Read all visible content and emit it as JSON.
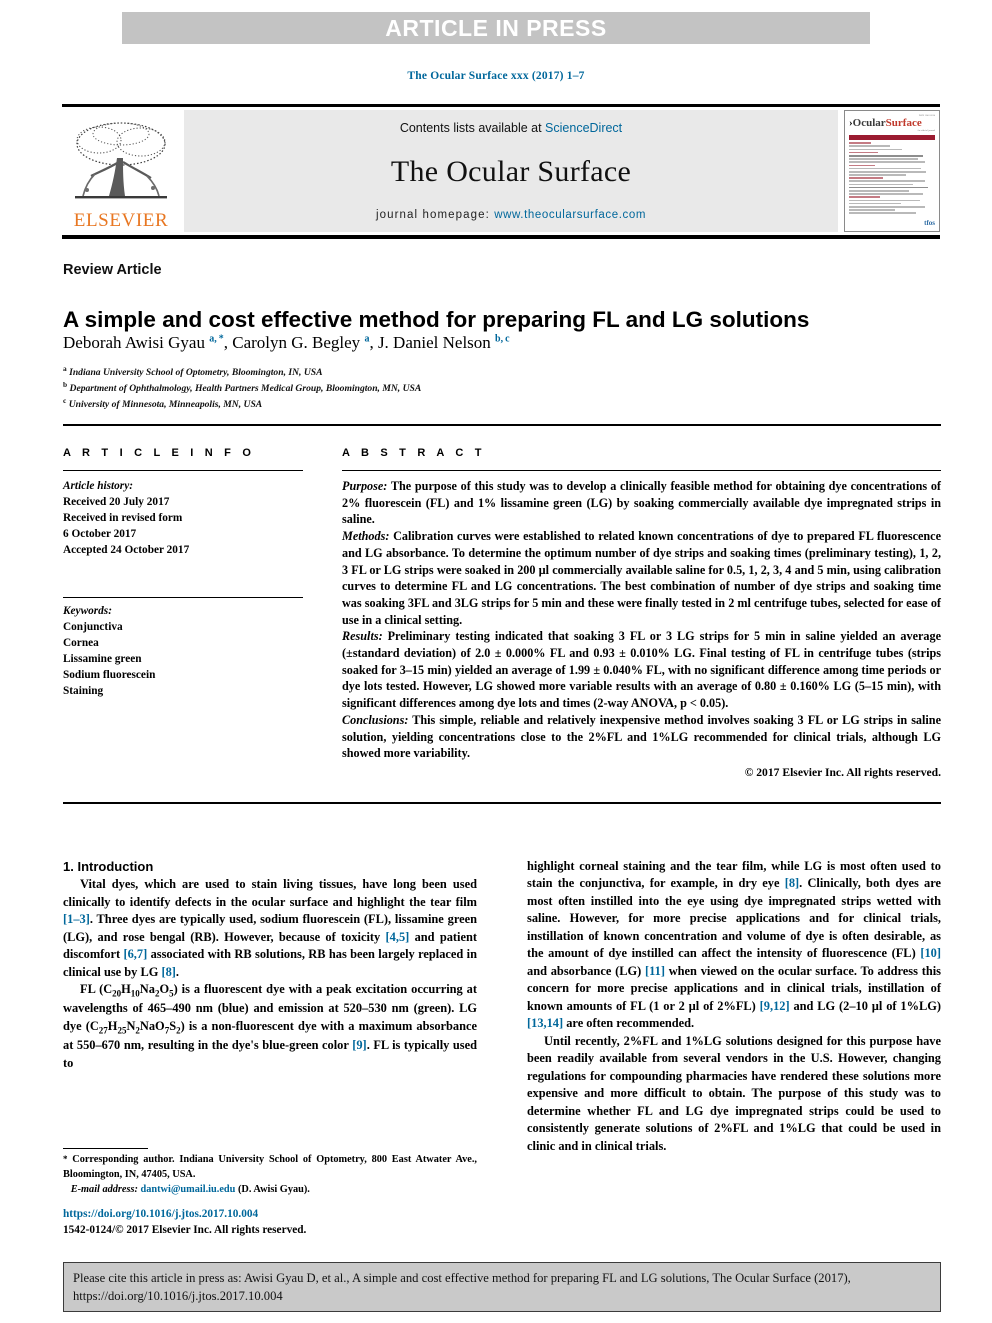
{
  "banner": {
    "text": "ARTICLE IN PRESS"
  },
  "running_head": {
    "text": "The Ocular Surface xxx (2017) 1–7"
  },
  "masthead": {
    "contents_prefix": "Contents lists available at ",
    "sciencedirect": "ScienceDirect",
    "journal_title": "The Ocular Surface",
    "homepage_label": "journal homepage:",
    "homepage_url": "www.theocularsurface.com",
    "publisher": "ELSEVIER",
    "cover_title_part1": "Ocular",
    "cover_title_part2": "Surface"
  },
  "article": {
    "type": "Review Article",
    "title": "A simple and cost effective method for preparing FL and LG solutions",
    "authors_html": "Deborah Awisi Gyau <sup>a, *</sup>, Carolyn G. Begley <sup>a</sup>, J. Daniel Nelson <sup>b, c</sup>",
    "affiliations": [
      {
        "mark": "a",
        "text": "Indiana University School of Optometry, Bloomington, IN, USA"
      },
      {
        "mark": "b",
        "text": "Department of Ophthalmology, Health Partners Medical Group, Bloomington, MN, USA"
      },
      {
        "mark": "c",
        "text": "University of Minnesota, Minneapolis, MN, USA"
      }
    ]
  },
  "info": {
    "heading": "A R T I C L E   I N F O",
    "history_label": "Article history:",
    "history": [
      "Received 20 July 2017",
      "Received in revised form",
      "6 October 2017",
      "Accepted 24 October 2017"
    ],
    "keywords_label": "Keywords:",
    "keywords": [
      "Conjunctiva",
      "Cornea",
      "Lissamine green",
      "Sodium fluorescein",
      "Staining"
    ]
  },
  "abstract": {
    "heading": "A B S T R A C T",
    "purpose_label": "Purpose:",
    "purpose_text": " The purpose of this study was to develop a clinically feasible method for obtaining dye concentrations of 2% fluorescein (FL) and 1% lissamine green (LG) by soaking commercially available dye impregnated strips in saline.",
    "methods_label": "Methods:",
    "methods_text": " Calibration curves were established to related known concentrations of dye to prepared FL fluorescence and LG absorbance. To determine the optimum number of dye strips and soaking times (preliminary testing), 1, 2, 3 FL or LG strips were soaked in 200 µl commercially available saline for 0.5, 1, 2, 3, 4 and 5 min, using calibration curves to determine FL and LG concentrations. The best combination of number of dye strips and soaking time was soaking 3FL and 3LG strips for 5 min and these were finally tested in 2 ml centrifuge tubes, selected for ease of use in a clinical setting.",
    "results_label": "Results:",
    "results_text": " Preliminary testing indicated that soaking 3 FL or 3 LG strips for 5 min in saline yielded an average (±standard deviation) of 2.0 ± 0.000% FL and 0.93 ± 0.010% LG. Final testing of FL in centrifuge tubes (strips soaked for 3–15 min) yielded an average of 1.99 ± 0.040% FL, with no significant difference among time periods or dye lots tested. However, LG showed more variable results with an average of 0.80 ± 0.160% LG (5–15 min), with significant differences among dye lots and times (2-way ANOVA, p < 0.05).",
    "conclusions_label": "Conclusions:",
    "conclusions_text": " This simple, reliable and relatively inexpensive method involves soaking 3 FL or LG strips in saline solution, yielding concentrations close to the 2%FL and 1%LG recommended for clinical trials, although LG showed more variability.",
    "copyright": "© 2017 Elsevier Inc. All rights reserved."
  },
  "body": {
    "section_heading": "1. Introduction",
    "left_para_1_html": "Vital dyes, which are used to stain living tissues, have long been used clinically to identify defects in the ocular surface and highlight the tear film <span class=\"ref\">[1–3]</span>. Three dyes are typically used, sodium fluorescein (FL), lissamine green (LG), and rose bengal (RB). However, because of toxicity <span class=\"ref\">[4,5]</span> and patient discomfort <span class=\"ref\">[6,7]</span> associated with RB solutions, RB has been largely replaced in clinical use by LG <span class=\"ref\">[8]</span>.",
    "left_para_2_html": "FL (C<sub>20</sub>H<sub>10</sub>Na<sub>2</sub>O<sub>5</sub>) is a fluorescent dye with a peak excitation occurring at wavelengths of 465–490 nm (blue) and emission at 520–530 nm (green). LG dye (C<sub>27</sub>H<sub>25</sub>N<sub>2</sub>NaO<sub>7</sub>S<sub>2</sub>) is a non-fluorescent dye with a maximum absorbance at 550–670 nm, resulting in the dye's blue-green color <span class=\"ref\">[9]</span>. FL is typically used to",
    "right_para_1_html": "highlight corneal staining and the tear film, while LG is most often used to stain the conjunctiva, for example, in dry eye <span class=\"ref\">[8]</span>. Clinically, both dyes are most often instilled into the eye using dye impregnated strips wetted with saline. However, for more precise applications and for clinical trials, instillation of known concentration and volume of dye is often desirable, as the amount of dye instilled can affect the intensity of fluorescence (FL) <span class=\"ref\">[10]</span> and absorbance (LG) <span class=\"ref\">[11]</span> when viewed on the ocular surface. To address this concern for more precise applications and in clinical trials, instillation of known amounts of FL (1 or 2 µl of 2%FL) <span class=\"ref\">[9,12]</span> and LG (2–10 µl of 1%LG) <span class=\"ref\">[13,14]</span> are often recommended.",
    "right_para_2_html": "Until recently, 2%FL and 1%LG solutions designed for this purpose have been readily available from several vendors in the U.S. However, changing regulations for compounding pharmacies have rendered these solutions more expensive and more difficult to obtain. The purpose of this study was to determine whether FL and LG dye impregnated strips could be used to consistently generate solutions of 2%FL and 1%LG that could be used in clinic and in clinical trials."
  },
  "footnote": {
    "corresponding_html": "<span class=\"star\">*</span> Corresponding author. Indiana University School of Optometry, 800 East Atwater Ave., Bloomington, IN, 47405, USA.",
    "email_label": "E-mail address:",
    "email": "dantwi@umail.iu.edu",
    "email_owner": "(D. Awisi Gyau).",
    "doi": "https://doi.org/10.1016/j.jtos.2017.10.004",
    "issn_line": "1542-0124/© 2017 Elsevier Inc. All rights reserved."
  },
  "cite_box": {
    "text": "Please cite this article in press as: Awisi Gyau D, et al., A simple and cost effective method for preparing FL and LG solutions, The Ocular Surface (2017), https://doi.org/10.1016/j.jtos.2017.10.004"
  },
  "colors": {
    "link": "#00679b",
    "elsevier_orange": "#e87722",
    "banner_gray": "#c3c3c3",
    "masthead_gray": "#e9e9e9",
    "cite_gray": "#c9c9c9"
  }
}
